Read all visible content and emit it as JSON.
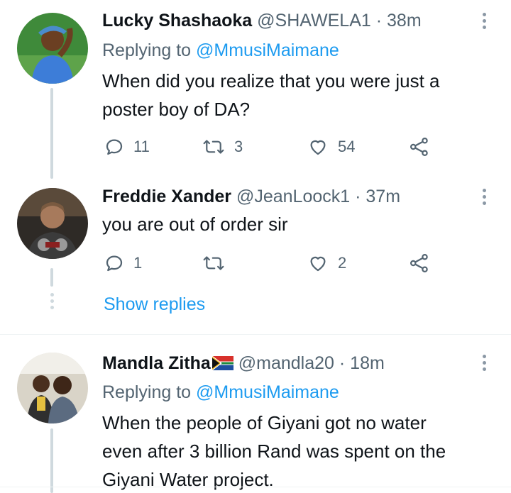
{
  "tweets": [
    {
      "name": "Lucky Shashaoka",
      "handle": "@SHAWELA1",
      "time": "38m",
      "replying_label": "Replying to",
      "replying_mention": "@MmusiMaimane",
      "text_lines": [
        "When did you realize that you were just a",
        "poster boy of DA?"
      ],
      "replies": "11",
      "retweets": "3",
      "likes": "54"
    },
    {
      "name": "Freddie Xander",
      "handle": "@JeanLoock1",
      "time": "37m",
      "text_lines": [
        "you are out of order sir"
      ],
      "replies": "1",
      "retweets": "",
      "likes": "2"
    },
    {
      "name": "Mandla Zitha",
      "handle": "@mandla20",
      "time": "18m",
      "replying_label": "Replying to",
      "replying_mention": "@MmusiMaimane",
      "text_lines": [
        "When the people of Giyani got no water",
        "even after 3 billion Rand was spent on the",
        "Giyani Water project."
      ]
    }
  ],
  "show_replies": "Show replies",
  "separator": "·",
  "icons": {
    "reply": "reply-icon",
    "retweet": "retweet-icon",
    "like": "heart-icon",
    "share": "share-icon",
    "more": "more-icon",
    "flag": "south-africa-flag-icon"
  },
  "colors": {
    "accent": "#1d9bf0",
    "secondary_text": "#536471",
    "thread_line": "#cfd9de"
  }
}
